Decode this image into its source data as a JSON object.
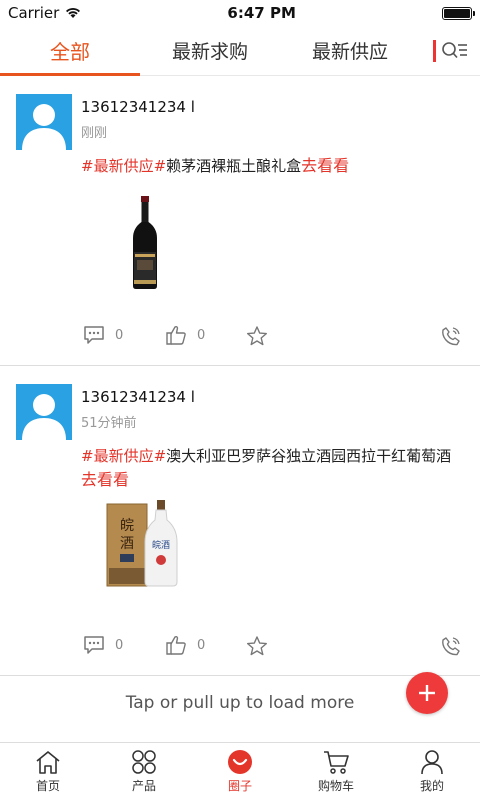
{
  "status_bar": {
    "carrier": "Carrier",
    "time": "6:47 PM",
    "battery_level": 1.0
  },
  "tabs": [
    {
      "label": "全部",
      "active": true
    },
    {
      "label": "最新求购",
      "active": false
    },
    {
      "label": "最新供应",
      "active": false
    }
  ],
  "posts": [
    {
      "user": "13612341234 l",
      "time": "刚刚",
      "tag": "#最新供应#",
      "text": "赖茅酒裸瓶土酿礼盒",
      "link": "去看看",
      "comments": "0",
      "likes": "0"
    },
    {
      "user": "13612341234 l",
      "time": "51分钟前",
      "tag": "#最新供应#",
      "text": "澳大利亚巴罗萨谷独立酒园西拉干红葡萄酒",
      "link": "去看看",
      "comments": "0",
      "likes": "0"
    }
  ],
  "load_more": "Tap or pull up to load more",
  "bottom_nav": [
    {
      "label": "首页",
      "icon": "home-icon",
      "active": false
    },
    {
      "label": "产品",
      "icon": "grid-icon",
      "active": false
    },
    {
      "label": "圈子",
      "icon": "circle-smile-icon",
      "active": true
    },
    {
      "label": "购物车",
      "icon": "cart-icon",
      "active": false
    },
    {
      "label": "我的",
      "icon": "user-icon",
      "active": false
    }
  ],
  "colors": {
    "accent": "#e8541e",
    "tag": "#e4352b",
    "avatar_bg": "#29a1e2",
    "fab": "#ee3a3a"
  }
}
